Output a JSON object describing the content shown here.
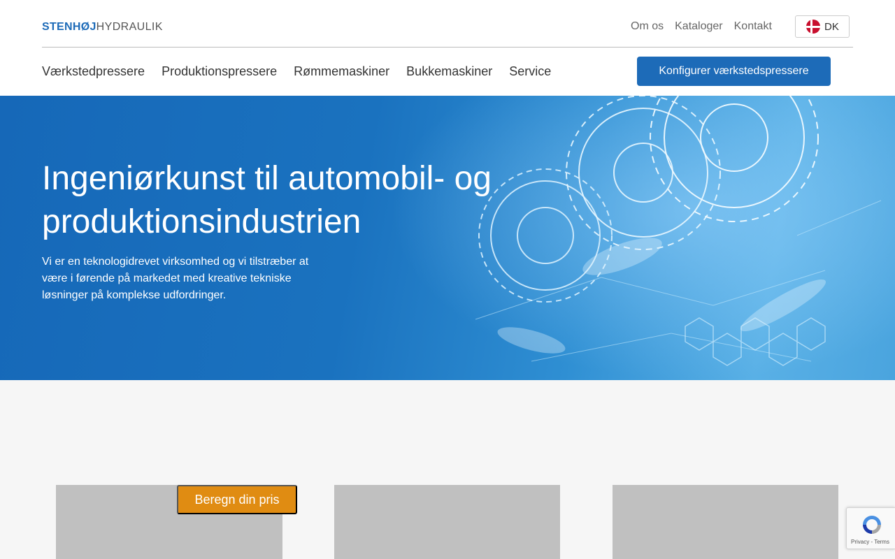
{
  "header": {
    "logo_bold": "STENHØJ",
    "logo_light": "HYDRAULIK",
    "top_links": [
      "Om os",
      "Kataloger",
      "Kontakt"
    ],
    "language": "DK",
    "main_nav": [
      "Værkstedpressere",
      "Produktionspressere",
      "Rømmemaskiner",
      "Bukkemaskiner",
      "Service"
    ],
    "cta_label": "Konfigurer værkstedspressere"
  },
  "hero": {
    "title": "Ingeniørkunst til automobil- og produktionsindustrien",
    "subtitle": "Vi er en teknologidrevet virksomhed og vi tilstræber at være i førende på markedet med kreative tekniske løsninger på komplekse udfordringer."
  },
  "lower": {
    "price_button": "Beregn din pris"
  },
  "recaptcha": {
    "text": "Privacy - Terms"
  },
  "colors": {
    "brand_blue": "#1d6bb8",
    "accent_orange": "#e08c12"
  }
}
